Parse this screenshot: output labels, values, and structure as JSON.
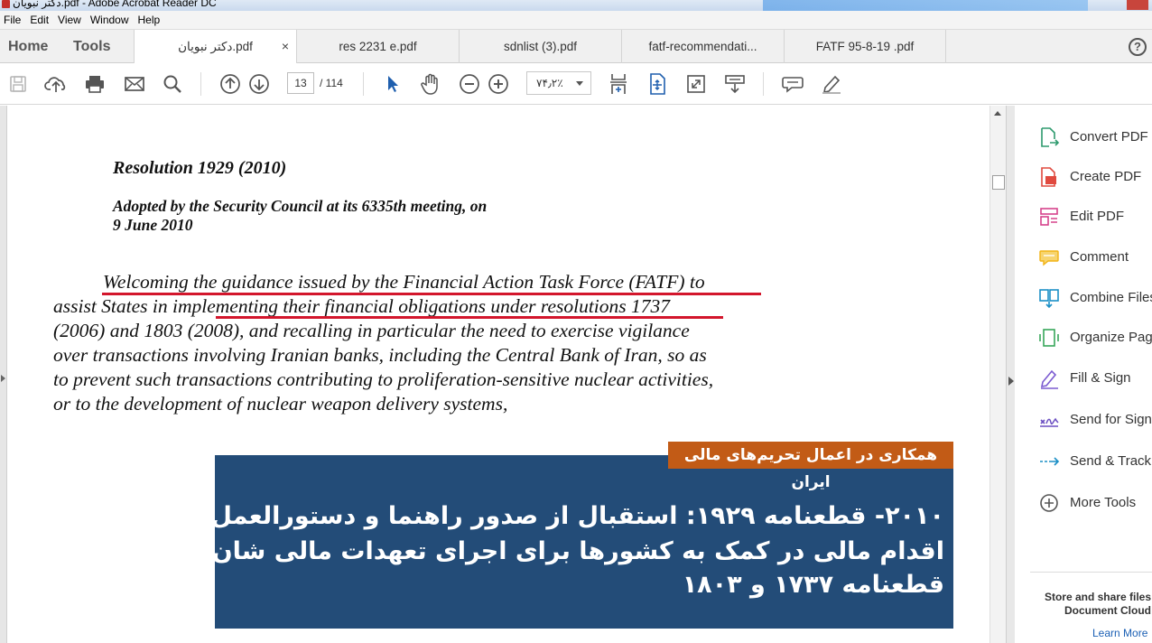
{
  "window": {
    "title": "دکتر نبویان.pdf - Adobe Acrobat Reader DC"
  },
  "menu": [
    "File",
    "Edit",
    "View",
    "Window",
    "Help"
  ],
  "nav": {
    "home": "Home",
    "tools": "Tools"
  },
  "tabs": [
    {
      "label": "دکتر نبویان.pdf",
      "active": true,
      "close": "×"
    },
    {
      "label": "res 2231 e.pdf"
    },
    {
      "label": "sdnlist (3).pdf"
    },
    {
      "label": "fatf-recommendati..."
    },
    {
      "label": "FATF  95-8-19  .pdf"
    }
  ],
  "help": "?",
  "toolbar": {
    "current_page": "13",
    "total_pages": "/  114",
    "zoom": "۷۴٫۲٪"
  },
  "document": {
    "title": "Resolution 1929 (2010)",
    "adopted_line1": "Adopted by the Security Council at its 6335th meeting, on",
    "adopted_line2": "9 June 2010",
    "para_lines": [
      "Welcoming the guidance issued by the Financial Action Task Force (FATF) to",
      "assist States in implementing their financial obligations under resolutions 1737",
      "(2006) and 1803 (2008), and recalling in particular the need to exercise vigilance",
      "over transactions involving Iranian banks, including the Central Bank of Iran, so as",
      "to prevent such transactions contributing to proliferation-sensitive nuclear activities,",
      "or to the development of nuclear weapon delivery systems,"
    ]
  },
  "overlay": {
    "badge": "همکاری در اعمال تحریم‌های مالی ایران",
    "lines": [
      "۲۰۱۰- قطعنامه ۱۹۲۹: استقبال از صدور راهنما و دستورالعمل گروه ویژه",
      "اقدام مالی در کمک به کشورها برای اجرای تعهدات مالی شان، تحت",
      "قطعنامه ۱۷۳۷ و ۱۸۰۳"
    ]
  },
  "tools_pane": {
    "items": [
      {
        "label": "Convert PDF",
        "icon": "convert-pdf-icon",
        "color": "#2e9a6e"
      },
      {
        "label": "Create PDF",
        "icon": "create-pdf-icon",
        "color": "#e04a3f"
      },
      {
        "label": "Edit PDF",
        "icon": "edit-pdf-icon",
        "color": "#d6438c"
      },
      {
        "label": "Comment",
        "icon": "comment-icon",
        "color": "#f2b315"
      },
      {
        "label": "Combine Files",
        "icon": "combine-files-icon",
        "color": "#1b8fc6"
      },
      {
        "label": "Organize Pages",
        "icon": "organize-pages-icon",
        "color": "#37a75a"
      },
      {
        "label": "Fill & Sign",
        "icon": "fill-sign-icon",
        "color": "#7b5bd1"
      },
      {
        "label": "Send for Signature",
        "icon": "send-for-signature-icon",
        "color": "#6b4fc2"
      },
      {
        "label": "Send & Track",
        "icon": "send-track-icon",
        "color": "#1b8fc6"
      },
      {
        "label": "More Tools",
        "icon": "more-tools-icon",
        "color": "#555555"
      }
    ],
    "store_line1": "Store and share files",
    "store_line2": "Document Cloud",
    "learn_more": "Learn More"
  }
}
